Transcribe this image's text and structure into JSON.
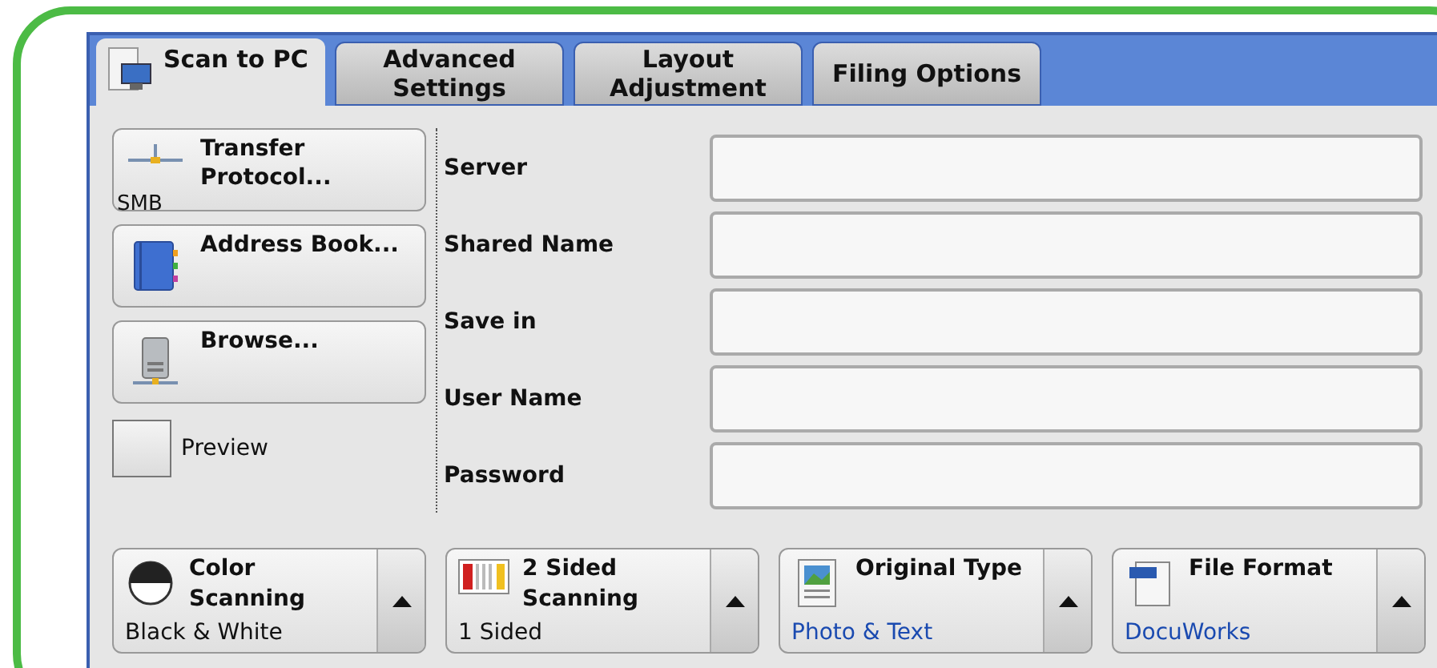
{
  "tabs": [
    {
      "label": "Scan to PC",
      "selected": true,
      "kind": "scan"
    },
    {
      "label": "Advanced Settings",
      "selected": false
    },
    {
      "label": "Layout Adjustment",
      "selected": false
    },
    {
      "label": "Filing Options",
      "selected": false
    }
  ],
  "actions": [
    {
      "kind": "protocol",
      "label": "Transfer Protocol...",
      "value": "SMB"
    },
    {
      "kind": "address",
      "label": "Address Book..."
    },
    {
      "kind": "browse",
      "label": "Browse..."
    }
  ],
  "preview": {
    "label": "Preview",
    "checked": false
  },
  "fields": [
    {
      "label": "Server"
    },
    {
      "label": "Shared Name"
    },
    {
      "label": "Save in"
    },
    {
      "label": "User Name"
    },
    {
      "label": "Password"
    }
  ],
  "features": [
    {
      "kind": "color",
      "title": "Color Scanning",
      "value": "Black & White",
      "highlighted": false
    },
    {
      "kind": "sided",
      "title": "2 Sided Scanning",
      "value": "1 Sided",
      "highlighted": false
    },
    {
      "kind": "original",
      "title": "Original Type",
      "value": "Photo & Text",
      "highlighted": true
    },
    {
      "kind": "format",
      "title": "File Format",
      "value": "DocuWorks",
      "highlighted": true
    }
  ]
}
